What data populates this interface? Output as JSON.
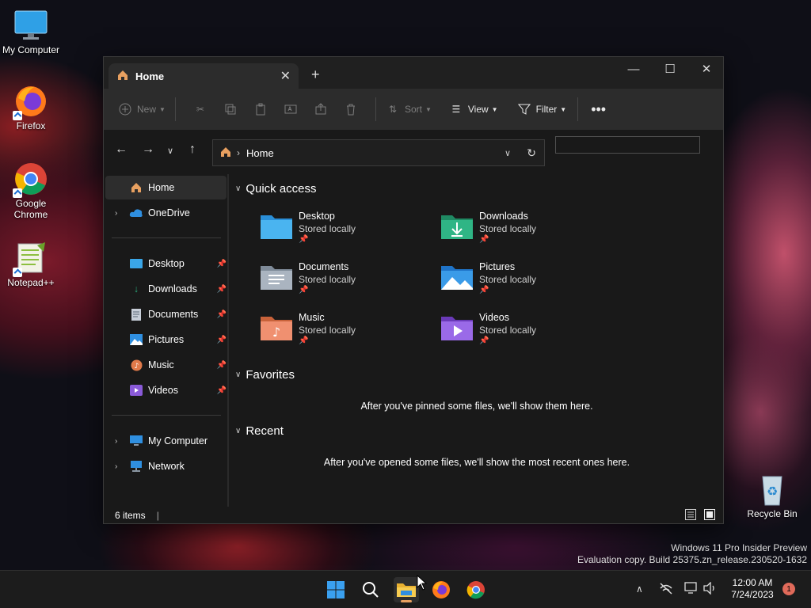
{
  "desktop": {
    "icons": [
      {
        "label": "My Computer"
      },
      {
        "label": "Firefox"
      },
      {
        "label": "Google Chrome"
      },
      {
        "label": "Notepad++"
      },
      {
        "label": "Recycle Bin"
      }
    ]
  },
  "window": {
    "tab_title": "Home",
    "toolbar": {
      "new": "New",
      "sort": "Sort",
      "view": "View",
      "filter": "Filter"
    },
    "address": {
      "location": "Home"
    },
    "sidebar": {
      "home": "Home",
      "onedrive": "OneDrive",
      "pinned": [
        "Desktop",
        "Downloads",
        "Documents",
        "Pictures",
        "Music",
        "Videos"
      ],
      "my_computer": "My Computer",
      "network": "Network"
    },
    "content": {
      "quick_access_title": "Quick access",
      "quick_access": [
        {
          "name": "Desktop",
          "status": "Stored locally"
        },
        {
          "name": "Downloads",
          "status": "Stored locally"
        },
        {
          "name": "Documents",
          "status": "Stored locally"
        },
        {
          "name": "Pictures",
          "status": "Stored locally"
        },
        {
          "name": "Music",
          "status": "Stored locally"
        },
        {
          "name": "Videos",
          "status": "Stored locally"
        }
      ],
      "favorites_title": "Favorites",
      "favorites_empty": "After you've pinned some files, we'll show them here.",
      "recent_title": "Recent",
      "recent_empty": "After you've opened some files, we'll show the most recent ones here."
    },
    "status": {
      "items": "6 items"
    }
  },
  "watermark": {
    "line1": "Windows 11 Pro Insider Preview",
    "line2": "Evaluation copy. Build 25375.zn_release.230520-1632"
  },
  "taskbar": {
    "time": "12:00 AM",
    "date": "7/24/2023",
    "notifications": "1"
  },
  "colors": {
    "accent": "#0078d4",
    "folder_blue": "#3aa6e8",
    "folder_green": "#2aa87a",
    "folder_music": "#e07a4a",
    "folder_video": "#8a5ad8"
  }
}
